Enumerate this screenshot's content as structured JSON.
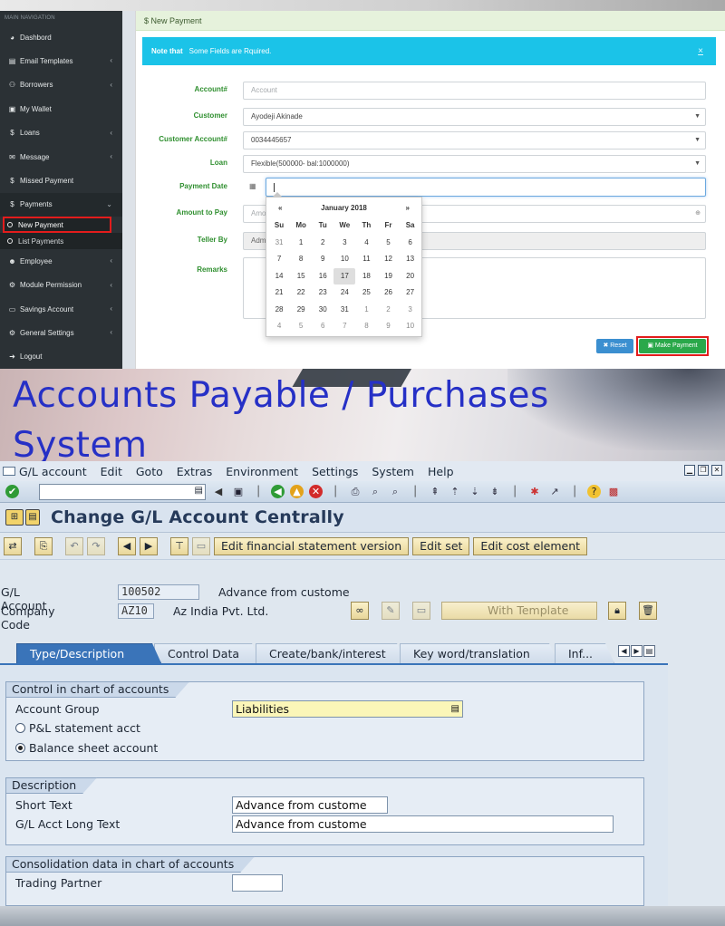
{
  "top_app": {
    "sidebar": {
      "header": "MAIN NAVIGATION",
      "items": [
        {
          "label": "Dashbord",
          "icon": "dashboard-icon",
          "glyph": "◕",
          "chev": false
        },
        {
          "label": "Email Templates",
          "icon": "envelope-icon",
          "glyph": "▤",
          "chev": true
        },
        {
          "label": "Borrowers",
          "icon": "users-icon",
          "glyph": "⚇",
          "chev": true
        },
        {
          "label": "My Wallet",
          "icon": "wallet-icon",
          "glyph": "▣",
          "chev": false
        },
        {
          "label": "Loans",
          "icon": "dollar-icon",
          "glyph": "$",
          "chev": true
        },
        {
          "label": "Message",
          "icon": "envelope-icon",
          "glyph": "✉",
          "chev": true
        },
        {
          "label": "Missed Payment",
          "icon": "dollar-icon",
          "glyph": "$",
          "chev": false
        },
        {
          "label": "Payments",
          "icon": "dollar-icon",
          "glyph": "$",
          "chev": true,
          "expanded": true
        }
      ],
      "sub_items": [
        {
          "label": "New Payment",
          "highlighted": true
        },
        {
          "label": "List Payments",
          "highlighted": false
        }
      ],
      "items_after": [
        {
          "label": "Employee",
          "icon": "user-icon",
          "glyph": "☻",
          "chev": true
        },
        {
          "label": "Module Permission",
          "icon": "gears-icon",
          "glyph": "⚙",
          "chev": true
        },
        {
          "label": "Savings Account",
          "icon": "card-icon",
          "glyph": "▭",
          "chev": true
        },
        {
          "label": "General Settings",
          "icon": "gear-icon",
          "glyph": "⚙",
          "chev": true
        },
        {
          "label": "Logout",
          "icon": "logout-icon",
          "glyph": "➜",
          "chev": false
        }
      ]
    },
    "panel_title": "$ New Payment",
    "alert": {
      "strong": "Note that",
      "text": "Some Fields are Rquired.",
      "close": "×"
    },
    "form": {
      "account_label": "Account#",
      "account_placeholder": "Account",
      "customer_label": "Customer",
      "customer_value": "Ayodeji Akinade",
      "customer_account_label": "Customer Account#",
      "customer_account_value": "0034445657",
      "loan_label": "Loan",
      "loan_value": "Flexible(500000- bal:1000000)",
      "payment_date_label": "Payment Date",
      "amount_label": "Amount to Pay",
      "amount_placeholder": "Amo",
      "teller_label": "Teller By",
      "teller_value": "Adm",
      "remarks_label": "Remarks"
    },
    "buttons": {
      "reset": "✖ Reset",
      "make_payment": "▣ Make Payment"
    },
    "calendar": {
      "prev": "«",
      "next": "»",
      "month": "January 2018",
      "days_of_week": [
        "Su",
        "Mo",
        "Tu",
        "We",
        "Th",
        "Fr",
        "Sa"
      ],
      "weeks": [
        [
          "31",
          "1",
          "2",
          "3",
          "4",
          "5",
          "6"
        ],
        [
          "7",
          "8",
          "9",
          "10",
          "11",
          "12",
          "13"
        ],
        [
          "14",
          "15",
          "16",
          "17",
          "18",
          "19",
          "20"
        ],
        [
          "21",
          "22",
          "23",
          "24",
          "25",
          "26",
          "27"
        ],
        [
          "28",
          "29",
          "30",
          "31",
          "1",
          "2",
          "3"
        ],
        [
          "4",
          "5",
          "6",
          "7",
          "8",
          "9",
          "10"
        ]
      ],
      "selected": "17"
    }
  },
  "banner": {
    "title": "Accounts Payable / Purchases System"
  },
  "sap": {
    "menu": [
      "G/L account",
      "Edit",
      "Goto",
      "Extras",
      "Environment",
      "Settings",
      "System",
      "Help"
    ],
    "title": "Change G/L Account Centrally",
    "app_buttons": [
      "Edit financial statement version",
      "Edit set",
      "Edit cost element"
    ],
    "gl_account_label": "G/L Account",
    "gl_account_value": "100502",
    "gl_account_desc": "Advance from custome",
    "company_code_label": "Company Code",
    "company_code_value": "AZ10",
    "company_code_desc": "Az India Pvt. Ltd.",
    "with_template": "With Template",
    "tabs": [
      "Type/Description",
      "Control Data",
      "Create/bank/interest",
      "Key word/translation",
      "Inf..."
    ],
    "group1": {
      "title": "Control in chart of accounts",
      "account_group_label": "Account Group",
      "account_group_value": "Liabilities",
      "radio1": "P&L statement acct",
      "radio2": "Balance sheet account"
    },
    "group2": {
      "title": "Description",
      "short_text_label": "Short Text",
      "short_text_value": "Advance from custome",
      "long_text_label": "G/L Acct Long Text",
      "long_text_value": "Advance from custome"
    },
    "group3": {
      "title": "Consolidation data in chart of accounts",
      "trading_partner_label": "Trading Partner"
    }
  }
}
